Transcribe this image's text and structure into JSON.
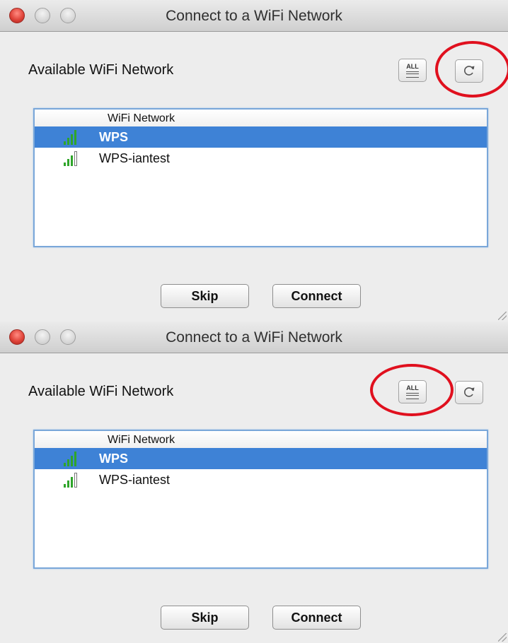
{
  "windows": [
    {
      "title": "Connect to a WiFi Network",
      "header_label": "Available WiFi Network",
      "all_button": {
        "icon": "list-all-icon",
        "glyph": "ALL"
      },
      "refresh_button": {
        "icon": "refresh-icon"
      },
      "highlighted": "refresh_button",
      "list": {
        "column_header": "WiFi Network",
        "networks": [
          {
            "name": "WPS",
            "selected": true,
            "signal_icon": "wifi-signal-icon"
          },
          {
            "name": "WPS-iantest",
            "selected": false,
            "signal_icon": "wifi-signal-icon"
          }
        ]
      },
      "buttons": {
        "skip": "Skip",
        "connect": "Connect"
      }
    },
    {
      "title": "Connect to a WiFi Network",
      "header_label": "Available WiFi Network",
      "all_button": {
        "icon": "list-all-icon",
        "glyph": "ALL"
      },
      "refresh_button": {
        "icon": "refresh-icon"
      },
      "highlighted": "all_button",
      "list": {
        "column_header": "WiFi Network",
        "networks": [
          {
            "name": "WPS",
            "selected": true,
            "signal_icon": "wifi-signal-icon"
          },
          {
            "name": "WPS-iantest",
            "selected": false,
            "signal_icon": "wifi-signal-icon"
          }
        ]
      },
      "buttons": {
        "skip": "Skip",
        "connect": "Connect"
      }
    }
  ],
  "colors": {
    "selection": "#3e82d6",
    "highlight_ring": "#e0101e",
    "signal_green": "#2fa52a",
    "close_red": "#e0443a"
  }
}
